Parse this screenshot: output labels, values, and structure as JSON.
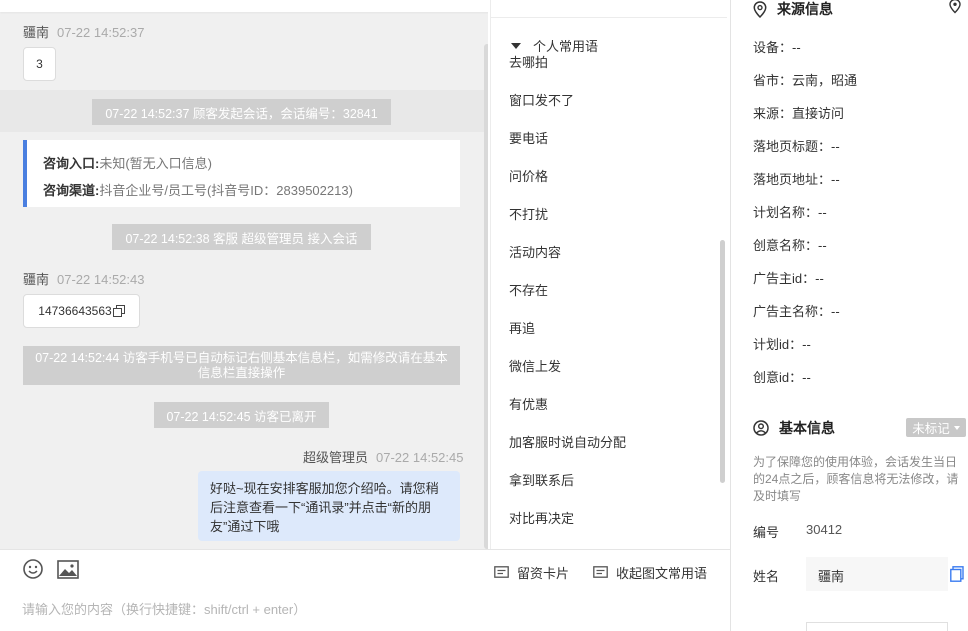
{
  "chat": {
    "msg1": {
      "sender": "疆南",
      "time": "07-22 14:52:37",
      "text": "3"
    },
    "sys1": "07-22 14:52:37 顾客发起会话，会话编号：32841",
    "entry_card": {
      "entry_label": "咨询入口:",
      "entry_value": "未知(暂无入口信息)",
      "channel_label": "咨询渠道:",
      "channel_value": "抖音企业号/员工号(抖音号ID：2839502213)"
    },
    "sys2": "07-22 14:52:38 客服 超级管理员 接入会话",
    "msg2": {
      "sender": "疆南",
      "time": "07-22 14:52:43",
      "text": "14736643563"
    },
    "sys3": "07-22 14:52:44 访客手机号已自动标记右侧基本信息栏，如需修改请在基本信息栏直接操作",
    "sys4": "07-22 14:52:45 访客已离开",
    "reply": {
      "sender": "超级管理员",
      "time": "07-22 14:52:45",
      "text": "好哒~现在安排客服加您介绍哈。请您稍后注意查看一下“通讯录”并点击“新的朋友”通过下哦"
    }
  },
  "input": {
    "placeholder": "请输入您的内容（换行快捷键：shift/ctrl + enter）",
    "card_btn": "留资卡片",
    "collapse_btn": "收起图文常用语"
  },
  "phrases": {
    "group": "个人常用语",
    "items": [
      "去哪拍",
      "窗口发不了",
      "要电话",
      "问价格",
      "不打扰",
      "活动内容",
      "不存在",
      "再追",
      "微信上发",
      "有优惠",
      "加客服时说自动分配",
      "拿到联系后",
      "对比再决定"
    ]
  },
  "source": {
    "title": "来源信息",
    "fields": [
      {
        "label": "设备：",
        "value": "--"
      },
      {
        "label": "省市：",
        "value": "云南，昭通"
      },
      {
        "label": "来源：",
        "value": "直接访问"
      },
      {
        "label": "落地页标题：",
        "value": "--"
      },
      {
        "label": "落地页地址：",
        "value": "--"
      },
      {
        "label": "计划名称：",
        "value": "--"
      },
      {
        "label": "创意名称：",
        "value": "--"
      },
      {
        "label": "广告主id：",
        "value": "--"
      },
      {
        "label": "广告主名称：",
        "value": "--"
      },
      {
        "label": "计划id：",
        "value": "--"
      },
      {
        "label": "创意id：",
        "value": "--"
      }
    ]
  },
  "basic": {
    "title": "基本信息",
    "tag": "未标记",
    "notice": "为了保障您的使用体验，会话发生当日的24点之后，顾客信息将无法修改，请及时填写",
    "id_label": "编号",
    "id_value": "30412",
    "name_label": "姓名",
    "name_value": "疆南"
  },
  "colors": {
    "accent": "#4a7fe0",
    "reply_bg": "#dde9fb",
    "system_bg": "#cfcfcf"
  }
}
